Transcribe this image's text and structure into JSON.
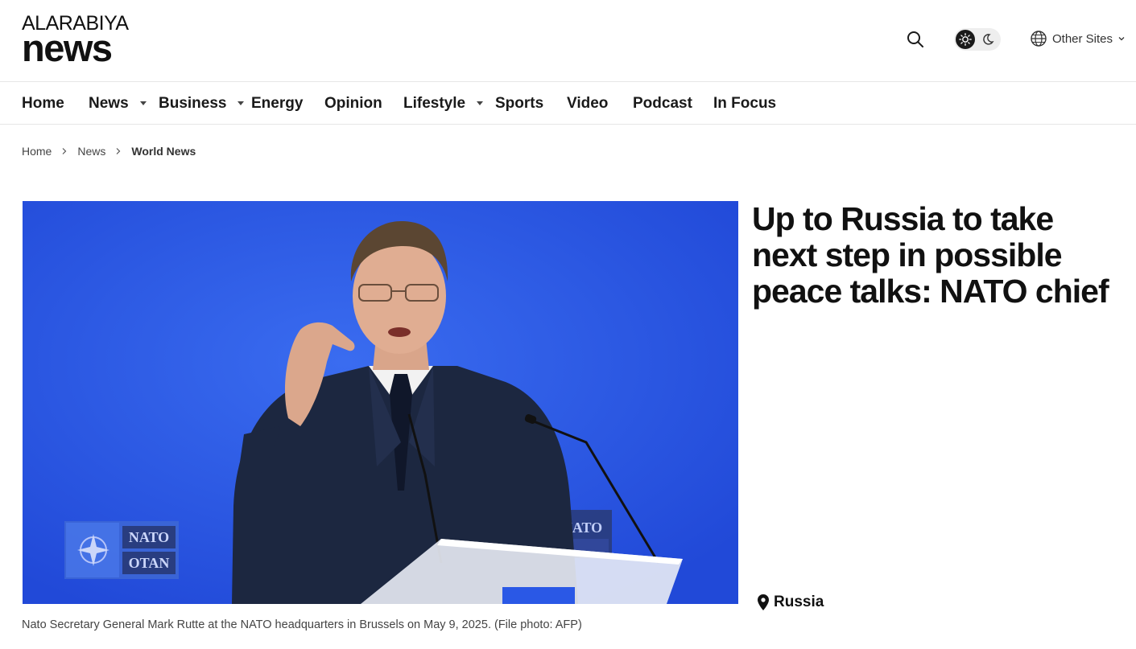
{
  "header": {
    "logo_top": "ALARABIYA",
    "logo_bottom": "news",
    "search_icon": "search-icon",
    "theme_light_icon": "sun-icon",
    "theme_dark_icon": "moon-icon",
    "other_sites_icon": "globe-icon",
    "other_sites_label": "Other Sites"
  },
  "nav": {
    "items": [
      {
        "label": "Home",
        "has_dropdown": false
      },
      {
        "label": "News",
        "has_dropdown": true
      },
      {
        "label": "Business",
        "has_dropdown": true
      },
      {
        "label": "Energy",
        "has_dropdown": false
      },
      {
        "label": "Opinion",
        "has_dropdown": false
      },
      {
        "label": "Lifestyle",
        "has_dropdown": true
      },
      {
        "label": "Sports",
        "has_dropdown": false
      },
      {
        "label": "Video",
        "has_dropdown": false
      },
      {
        "label": "Podcast",
        "has_dropdown": false
      },
      {
        "label": "In Focus",
        "has_dropdown": false
      }
    ]
  },
  "breadcrumb": {
    "items": [
      "Home",
      "News",
      "World News"
    ]
  },
  "article": {
    "headline": "Up to Russia to take next step in possible peace talks: NATO chief",
    "image_caption": "Nato Secretary General Mark Rutte at the NATO headquarters in Brussels on May 9, 2025. (File photo: AFP)",
    "image_signs": [
      "NATO",
      "OTAN"
    ],
    "location_tag": "Russia",
    "location_icon": "map-pin-icon"
  },
  "colors": {
    "hero_background": "#2a58e6",
    "text": "#111111",
    "border": "#e6e6e6"
  }
}
